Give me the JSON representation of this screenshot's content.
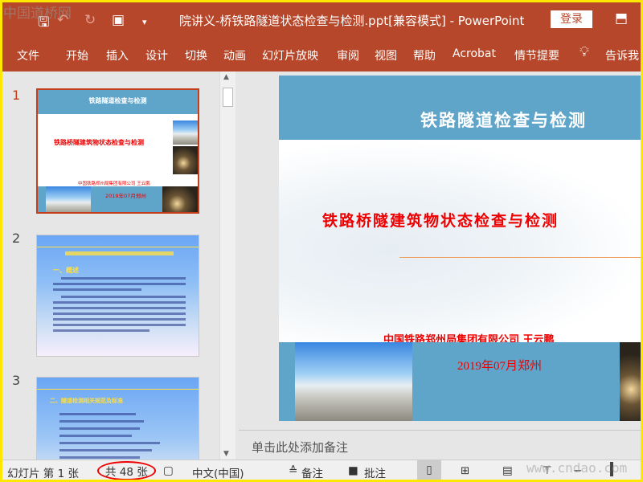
{
  "window": {
    "title": "院讲义-桥铁路隧道状态检查与检测.ppt[兼容模式]  -  PowerPoint",
    "login_label": "登录",
    "accent": "#b7472a",
    "border": "#ffe800"
  },
  "watermark": {
    "top": "中国道桥网",
    "bottom": "www.cndao.com"
  },
  "ribbon": {
    "tabs": [
      "文件",
      "开始",
      "插入",
      "设计",
      "切换",
      "动画",
      "幻灯片放映",
      "审阅",
      "视图",
      "帮助",
      "Acrobat",
      "情节提要",
      "告诉我"
    ]
  },
  "thumbnails": [
    {
      "number": "1",
      "title": "铁路隧道检查与检测",
      "subtitle": "铁路桥隧建筑物状态检查与检测",
      "org": "中国铁路郑州局集团有限公司  王云鹏",
      "date": "2019年07月郑州",
      "selected": true
    },
    {
      "number": "2",
      "heading": "一、概述"
    },
    {
      "number": "3",
      "heading": "二、隧道检测相关规范及标准"
    }
  ],
  "slide": {
    "title": "铁路隧道检查与检测",
    "subtitle": "铁路桥隧建筑物状态检查与检测",
    "org": "中国铁路郑州局集团有限公司    王云鹏",
    "date": "2019年07月郑州",
    "band_color": "#5fa4c9",
    "text_color": "#e00000"
  },
  "notes": {
    "placeholder": "单击此处添加备注"
  },
  "status": {
    "slide_label": "幻灯片 第 1 张",
    "total": "共 48 张",
    "language": "中文(中国)",
    "notes_label": "备注",
    "comments_label": "批注"
  }
}
